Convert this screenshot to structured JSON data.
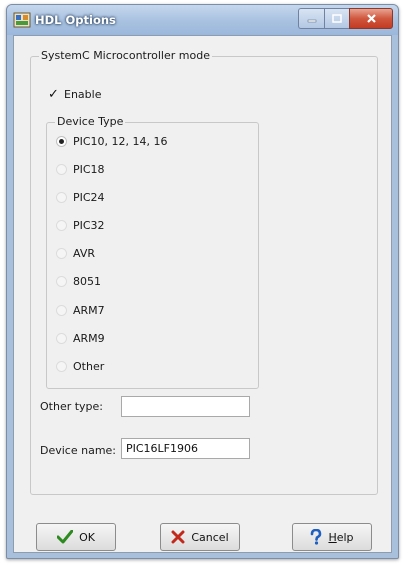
{
  "window": {
    "title": "HDL Options",
    "accent_color": "#a8c1e0",
    "close_color": "#c94a30"
  },
  "main_group": {
    "label": "SystemC Microcontroller mode",
    "enable": {
      "label": "Enable",
      "checked": true
    }
  },
  "device_type": {
    "label": "Device Type",
    "options": [
      {
        "label": "PIC10, 12, 14, 16",
        "selected": true
      },
      {
        "label": "PIC18",
        "selected": false
      },
      {
        "label": "PIC24",
        "selected": false
      },
      {
        "label": "PIC32",
        "selected": false
      },
      {
        "label": "AVR",
        "selected": false
      },
      {
        "label": "8051",
        "selected": false
      },
      {
        "label": "ARM7",
        "selected": false
      },
      {
        "label": "ARM9",
        "selected": false
      },
      {
        "label": "Other",
        "selected": false
      }
    ]
  },
  "fields": {
    "other_type": {
      "label": "Other type:",
      "value": ""
    },
    "device_name": {
      "label": "Device name:",
      "value": "PIC16LF1906"
    }
  },
  "buttons": {
    "ok": {
      "label": "OK",
      "icon": "checkmark-icon",
      "color": "#2d8a1e"
    },
    "cancel": {
      "label": "Cancel",
      "icon": "cross-icon",
      "color": "#c2281b"
    },
    "help": {
      "label": "Help",
      "icon": "question-icon",
      "color": "#1f5fbf"
    }
  }
}
